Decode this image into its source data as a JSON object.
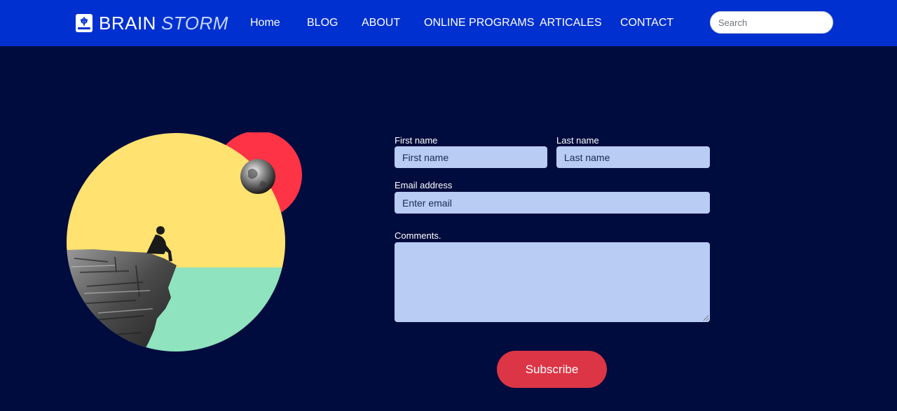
{
  "brand": {
    "part1": "BRAIN",
    "part2": "STORM"
  },
  "nav": {
    "items": [
      "Home",
      "BLOG",
      "ABOUT",
      "ONLINE PROGRAMS",
      "ARTICALES",
      "CONTACT"
    ],
    "search_placeholder": "Search"
  },
  "form": {
    "first_name": {
      "label": "First name",
      "placeholder": "First name"
    },
    "last_name": {
      "label": "Last name",
      "placeholder": "Last name"
    },
    "email": {
      "label": "Email address",
      "placeholder": "Enter email"
    },
    "comments": {
      "label": "Comments."
    },
    "submit_label": "Subscribe"
  },
  "colors": {
    "navbar": "#0130d0",
    "background": "#000c3d",
    "field": "#b9ccf4",
    "button": "#dc3545",
    "sun": "#ff3346",
    "sky": "#ffe26f",
    "sea": "#8fe3bf"
  }
}
